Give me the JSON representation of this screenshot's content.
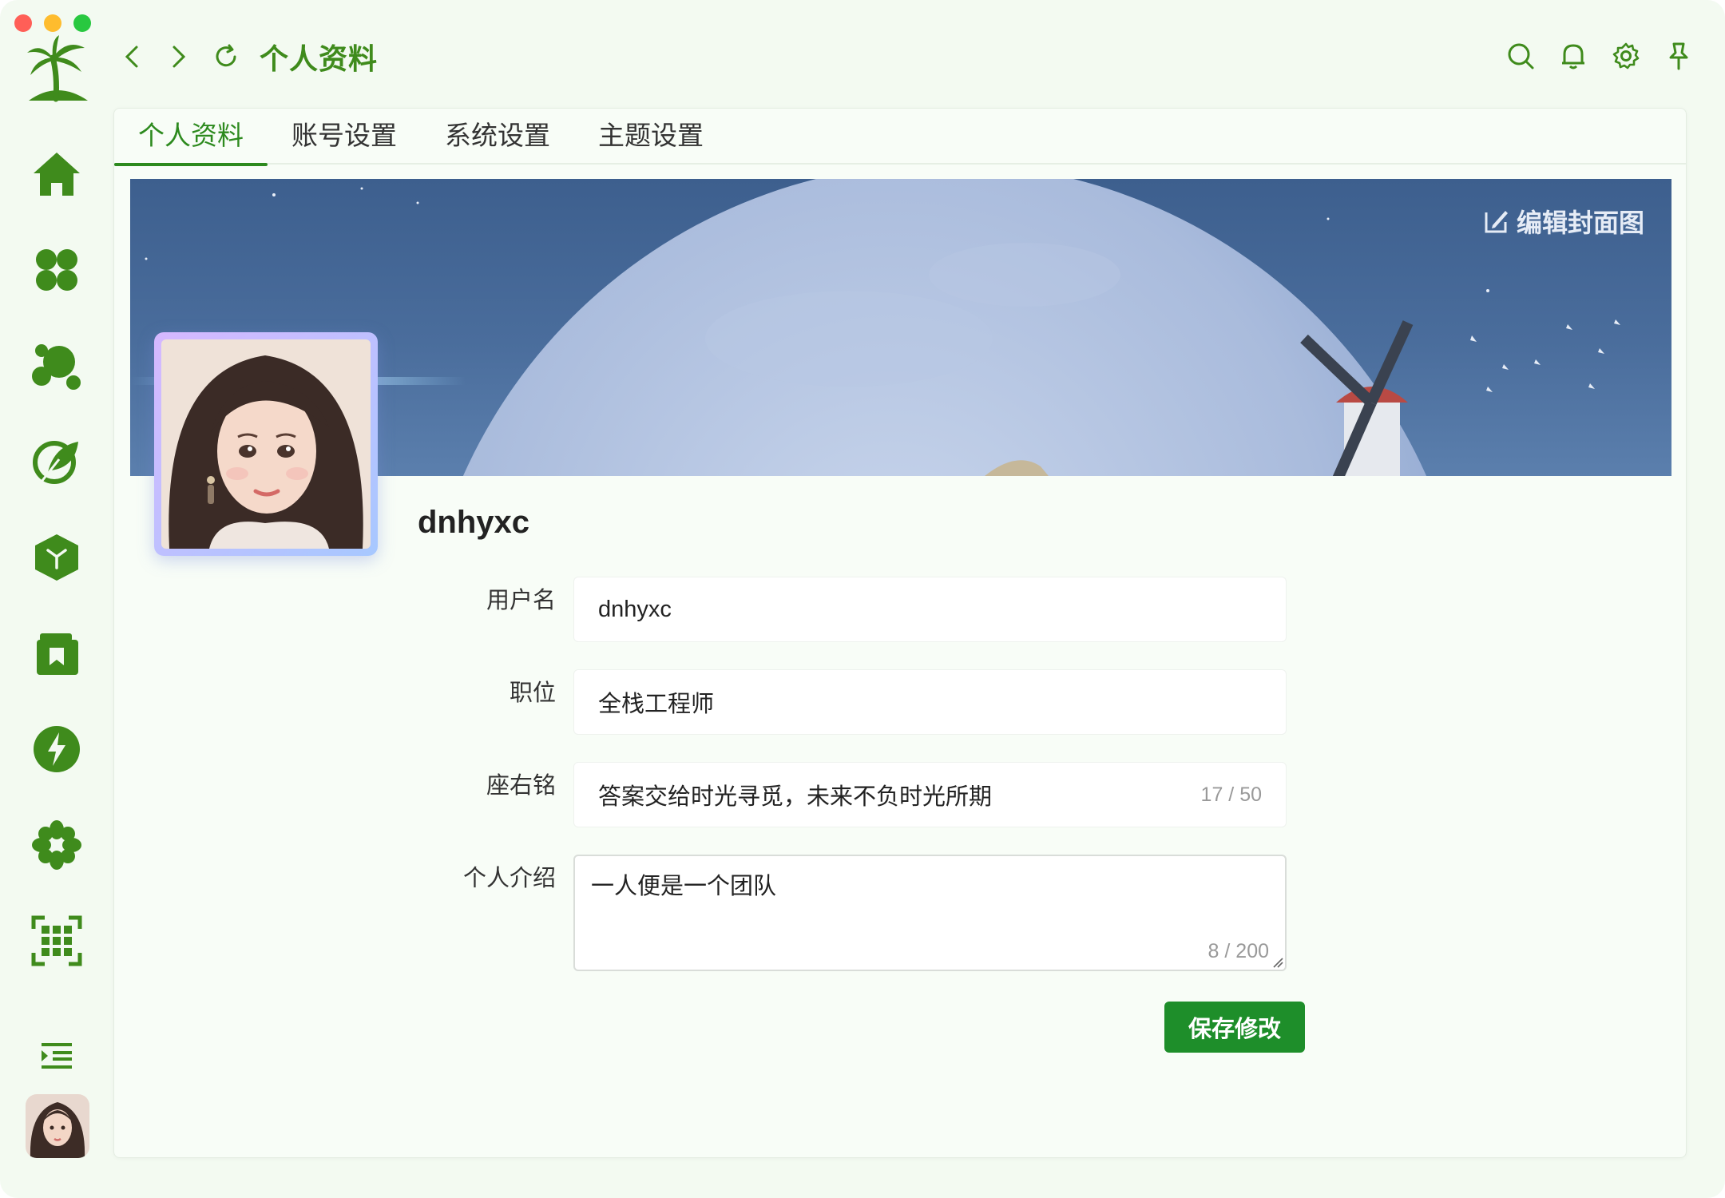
{
  "window": {
    "title": "个人资料"
  },
  "topbar": {
    "back_icon": "chevron-left-icon",
    "forward_icon": "chevron-right-icon",
    "refresh_icon": "refresh-icon",
    "title": "个人资料",
    "actions": [
      "search-icon",
      "bell-icon",
      "gear-icon",
      "pin-icon"
    ]
  },
  "sidebar": {
    "items": [
      {
        "icon": "home-icon"
      },
      {
        "icon": "clover-icon"
      },
      {
        "icon": "bubbles-icon"
      },
      {
        "icon": "leaf-icon"
      },
      {
        "icon": "cube-icon"
      },
      {
        "icon": "bookmark-folder-icon"
      },
      {
        "icon": "lightning-icon"
      },
      {
        "icon": "flower-icon"
      },
      {
        "icon": "grid-scan-icon"
      }
    ],
    "menu_icon": "menu-indent-icon"
  },
  "tabs": [
    {
      "label": "个人资料",
      "active": true
    },
    {
      "label": "账号设置",
      "active": false
    },
    {
      "label": "系统设置",
      "active": false
    },
    {
      "label": "主题设置",
      "active": false
    }
  ],
  "cover": {
    "edit_label": "编辑封面图"
  },
  "profile": {
    "display_name": "dnhyxc"
  },
  "form": {
    "username": {
      "label": "用户名",
      "value": "dnhyxc"
    },
    "position": {
      "label": "职位",
      "value": "全栈工程师"
    },
    "motto": {
      "label": "座右铭",
      "value": "答案交给时光寻觅，未来不负时光所期",
      "counter": "17 / 50"
    },
    "intro": {
      "label": "个人介绍",
      "value": "一人便是一个团队",
      "counter": "8 / 200"
    }
  },
  "actions": {
    "save_label": "保存修改"
  },
  "colors": {
    "accent": "#2d8a1e",
    "button": "#1e8e2a",
    "icon_green": "#3f8b1c"
  }
}
